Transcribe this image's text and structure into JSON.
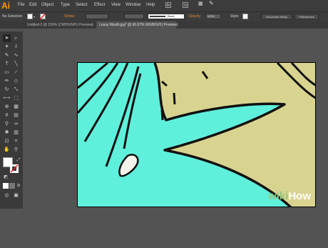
{
  "app": {
    "logo": "Ai"
  },
  "menu": {
    "items": [
      "File",
      "Edit",
      "Object",
      "Type",
      "Select",
      "Effect",
      "View",
      "Window",
      "Help"
    ]
  },
  "bridge_buttons": [
    "Br",
    "St"
  ],
  "control_bar": {
    "selection_label": "No Selection",
    "stroke_label": "Stroke:",
    "brush_preset": "Basic",
    "opacity_label": "Opacity:",
    "opacity_value": "100%",
    "style_label": "Style:",
    "document_setup_button": "Document Setup",
    "preferences_button": "Preferences"
  },
  "tabs": [
    {
      "label": "Untitled-2 @ 150% (CMYK/GPU Preview)",
      "active": false
    },
    {
      "label": "Lousy Mouth.jpg* @ 66.67% (RGB/GPU Preview)",
      "active": true
    }
  ],
  "tools": [
    [
      "selection-tool",
      "➤"
    ],
    [
      "direct-selection-tool",
      "▹"
    ],
    [
      "magic-wand-tool",
      "✦"
    ],
    [
      "lasso-tool",
      "ℓ"
    ],
    [
      "pen-tool",
      "✎"
    ],
    [
      "curvature-tool",
      "∿"
    ],
    [
      "type-tool",
      "T"
    ],
    [
      "line-segment-tool",
      "╲"
    ],
    [
      "rectangle-tool",
      "▭"
    ],
    [
      "paintbrush-tool",
      "∕"
    ],
    [
      "pencil-tool",
      "✏"
    ],
    [
      "eraser-tool",
      "◇"
    ],
    [
      "rotate-tool",
      "↻"
    ],
    [
      "scale-tool",
      "⤡"
    ],
    [
      "width-tool",
      "⟷"
    ],
    [
      "free-transform-tool",
      "⬚"
    ],
    [
      "shape-builder-tool",
      "⊕"
    ],
    [
      "perspective-grid-tool",
      "▦"
    ],
    [
      "mesh-tool",
      "#"
    ],
    [
      "gradient-tool",
      "▤"
    ],
    [
      "eyedropper-tool",
      "⚲"
    ],
    [
      "blend-tool",
      "∞"
    ],
    [
      "symbol-sprayer-tool",
      "✺"
    ],
    [
      "column-graph-tool",
      "▥"
    ],
    [
      "artboard-tool",
      "⊡"
    ],
    [
      "slice-tool",
      "⌗"
    ],
    [
      "hand-tool",
      "✋"
    ],
    [
      "zoom-tool",
      "⚲"
    ]
  ],
  "colors": {
    "menubar": "#3c3c3c",
    "workspace": "#535353",
    "canvas_background": "#5ff0dc",
    "face": "#d8d490",
    "line": "#111111"
  },
  "watermark": {
    "part1": "wiki",
    "part2": "How"
  }
}
